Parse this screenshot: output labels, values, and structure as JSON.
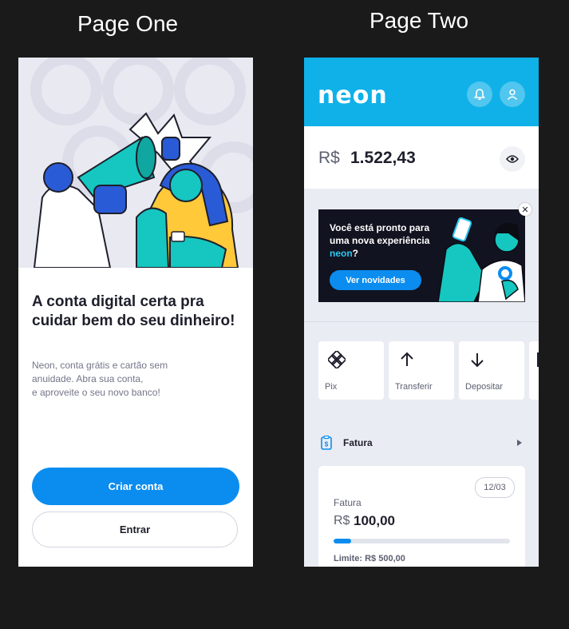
{
  "headings": {
    "page_one": "Page One",
    "page_two": "Page Two"
  },
  "page_one": {
    "title": "A conta digital certa pra cuidar bem do seu dinheiro!",
    "description": "Neon, conta grátis e cartão sem\nanuidade. Abra sua conta,\ne aproveite o seu novo banco!",
    "primary_button": "Criar conta",
    "secondary_button": "Entrar"
  },
  "page_two": {
    "logo": "neon",
    "balance": {
      "currency": "R$",
      "value": "1.522,43"
    },
    "banner": {
      "text_before": "Você está pronto para uma nova experiência ",
      "highlight": "neon",
      "text_after": "?",
      "button": "Ver novidades"
    },
    "actions": [
      {
        "label": "Pix",
        "icon": "pix-icon"
      },
      {
        "label": "Transferir",
        "icon": "arrow-up-icon"
      },
      {
        "label": "Depositar",
        "icon": "arrow-down-icon"
      }
    ],
    "fatura_section": {
      "label": "Fatura"
    },
    "fatura_card": {
      "date": "12/03",
      "title": "Fatura",
      "currency": "R$",
      "value": "100,00",
      "progress": 0.1,
      "limit": "Limite: R$ 500,00"
    }
  },
  "colors": {
    "brand_blue": "#0fb1e8",
    "button_blue": "#0b8df0",
    "accent_cyan": "#28c7f0",
    "dark": "#121320"
  }
}
